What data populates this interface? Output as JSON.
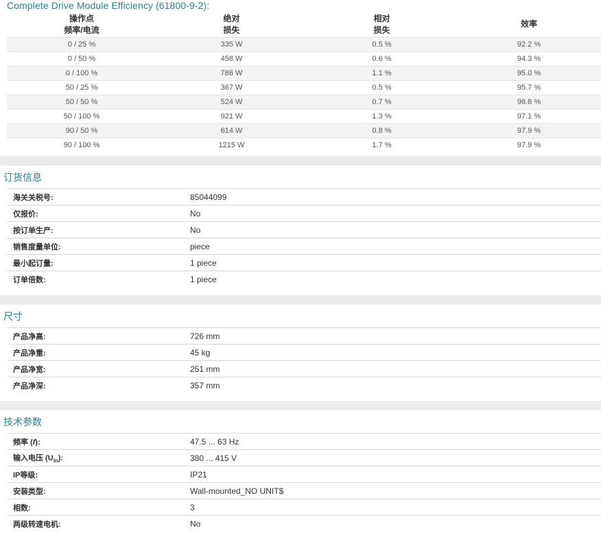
{
  "efficiency": {
    "title": "Complete Drive Module Efficiency (61800-9-2):",
    "headers": [
      {
        "line1": "操作点",
        "line2": "频率/电流"
      },
      {
        "line1": "绝对",
        "line2": "损失"
      },
      {
        "line1": "相对",
        "line2": "损失"
      },
      {
        "line1": "效率",
        "line2": ""
      }
    ],
    "rows": [
      [
        "0 / 25 %",
        "335 W",
        "0.5 %",
        "92.2 %"
      ],
      [
        "0 / 50 %",
        "458 W",
        "0.6 %",
        "94.3 %"
      ],
      [
        "0 / 100 %",
        "786 W",
        "1.1 %",
        "95.0 %"
      ],
      [
        "50 / 25 %",
        "367 W",
        "0.5 %",
        "95.7 %"
      ],
      [
        "50 / 50 %",
        "524 W",
        "0.7 %",
        "96.8 %"
      ],
      [
        "50 / 100 %",
        "921 W",
        "1.3 %",
        "97.1 %"
      ],
      [
        "90 / 50 %",
        "614 W",
        "0.8 %",
        "97.9 %"
      ],
      [
        "90 / 100 %",
        "1215 W",
        "1.7 %",
        "97.9 %"
      ]
    ]
  },
  "ordering": {
    "title": "订货信息",
    "rows": [
      {
        "label": "海关关税号:",
        "value": "85044099"
      },
      {
        "label": "仅报价:",
        "value": "No"
      },
      {
        "label": "按订单生产:",
        "value": "No"
      },
      {
        "label": "销售度量单位:",
        "value": "piece"
      },
      {
        "label": "最小起订量:",
        "value": "1 piece"
      },
      {
        "label": "订单倍数:",
        "value": "1 piece"
      }
    ]
  },
  "dimensions": {
    "title": "尺寸",
    "rows": [
      {
        "label": "产品净高:",
        "value": "726 mm"
      },
      {
        "label": "产品净重:",
        "value": "45 kg"
      },
      {
        "label": "产品净宽:",
        "value": "251 mm"
      },
      {
        "label": "产品净深:",
        "value": "357 mm"
      }
    ]
  },
  "technical": {
    "title": "技术参数",
    "rows": [
      {
        "label": "频率 (",
        "sym": "f",
        "sub": "",
        "tail": "):",
        "value": "47.5 ... 63 Hz"
      },
      {
        "label": "输入电压 (",
        "sym": "U",
        "sub": "in",
        "tail": "):",
        "value": "380 ... 415 V"
      },
      {
        "label": "IP等级:",
        "sym": "",
        "sub": "",
        "tail": "",
        "value": "IP21"
      },
      {
        "label": "安装类型:",
        "sym": "",
        "sub": "",
        "tail": "",
        "value": "Wall-mounted_NO UNIT$"
      },
      {
        "label": "相数:",
        "sym": "",
        "sub": "",
        "tail": "",
        "value": "3"
      },
      {
        "label": "两级转速电机:",
        "sym": "",
        "sub": "",
        "tail": "",
        "value": "No"
      }
    ]
  }
}
